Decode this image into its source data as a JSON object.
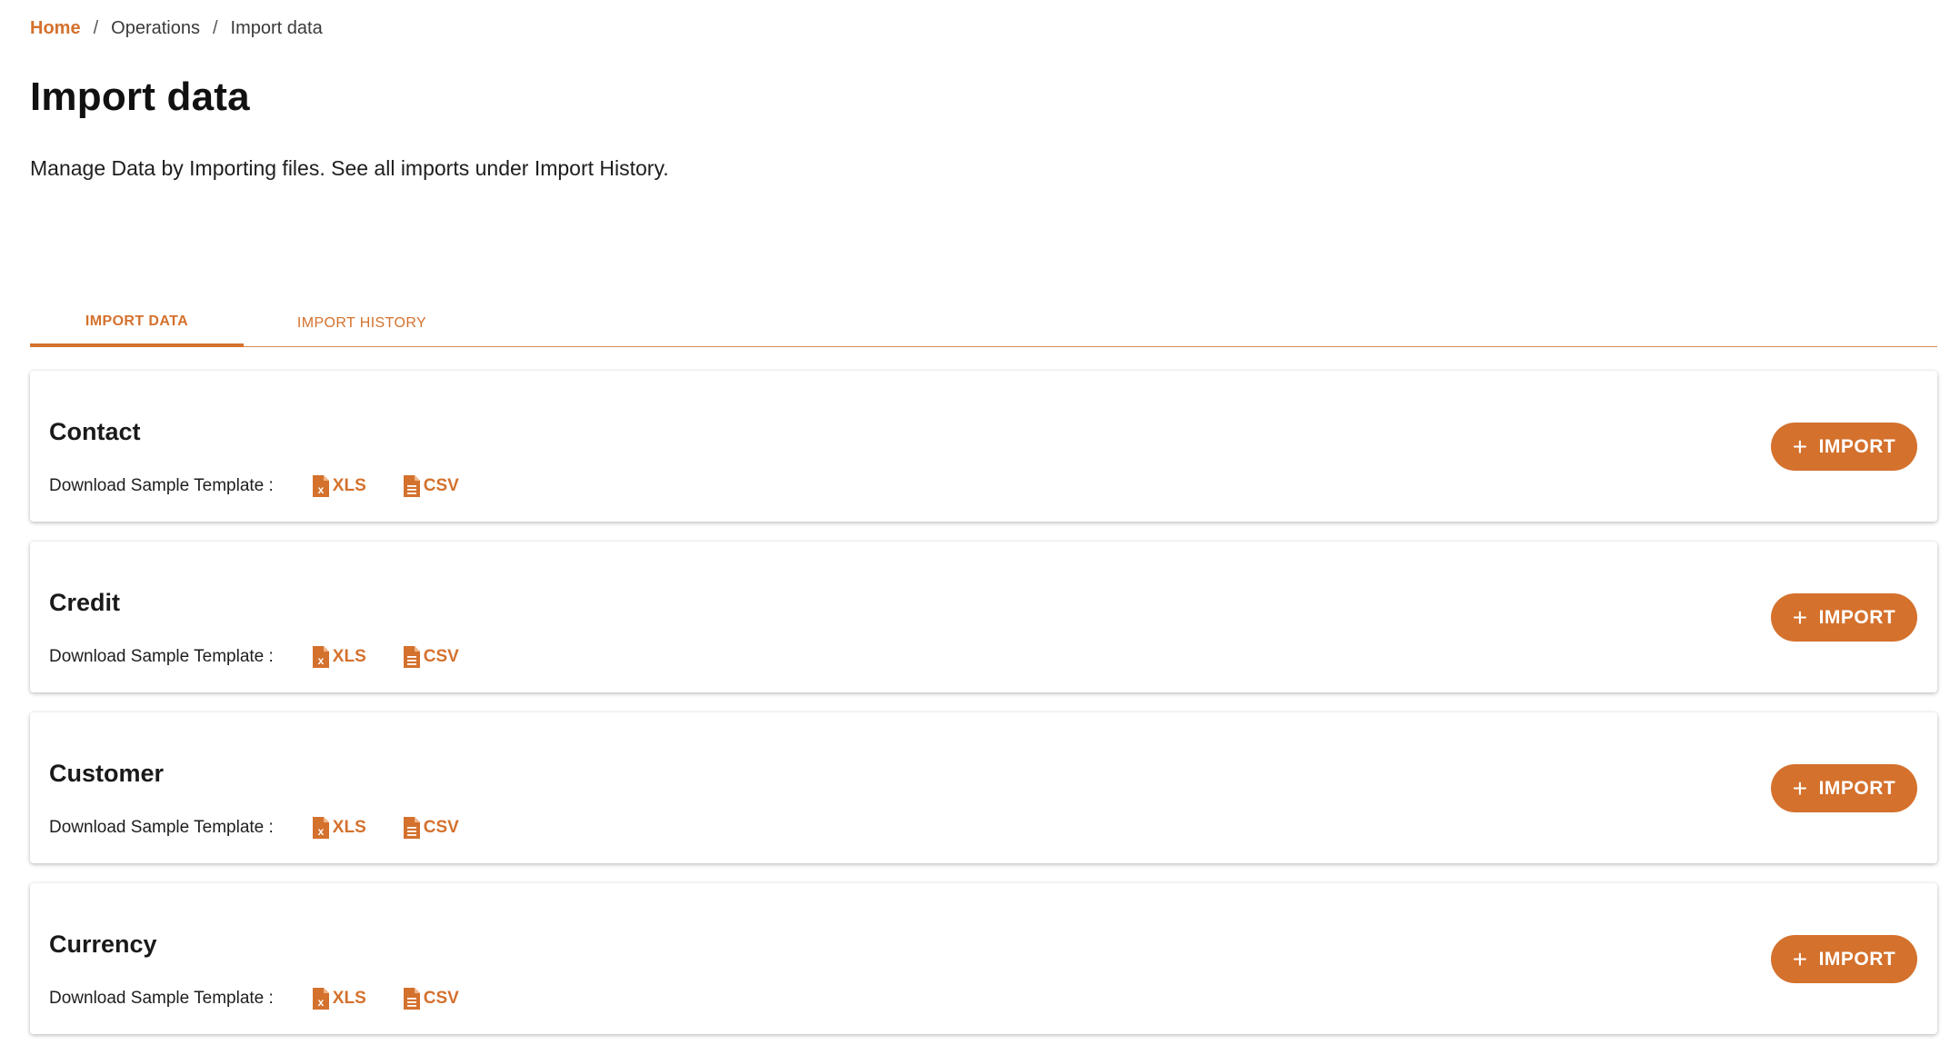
{
  "breadcrumb": {
    "home": "Home",
    "separator": "/",
    "operations": "Operations",
    "current": "Import data"
  },
  "page": {
    "title": "Import data",
    "description": "Manage Data by Importing files. See all imports under Import History."
  },
  "tabs": [
    {
      "label": "IMPORT DATA",
      "active": true
    },
    {
      "label": "IMPORT HISTORY",
      "active": false
    }
  ],
  "cards": [
    {
      "title": "Contact",
      "download_label": "Download Sample Template :",
      "xls_label": "XLS",
      "csv_label": "CSV",
      "import_label": "IMPORT",
      "import_icon": "+"
    },
    {
      "title": "Credit",
      "download_label": "Download Sample Template :",
      "xls_label": "XLS",
      "csv_label": "CSV",
      "import_label": "IMPORT",
      "import_icon": "+"
    },
    {
      "title": "Customer",
      "download_label": "Download Sample Template :",
      "xls_label": "XLS",
      "csv_label": "CSV",
      "import_label": "IMPORT",
      "import_icon": "+"
    },
    {
      "title": "Currency",
      "download_label": "Download Sample Template :",
      "xls_label": "XLS",
      "csv_label": "CSV",
      "import_label": "IMPORT",
      "import_icon": "+"
    }
  ],
  "colors": {
    "accent": "#d4712d",
    "text": "#1a1a1a",
    "background": "#ffffff"
  },
  "icons": {
    "xls": "xls-file-icon",
    "csv": "csv-file-icon",
    "import": "plus-icon"
  }
}
